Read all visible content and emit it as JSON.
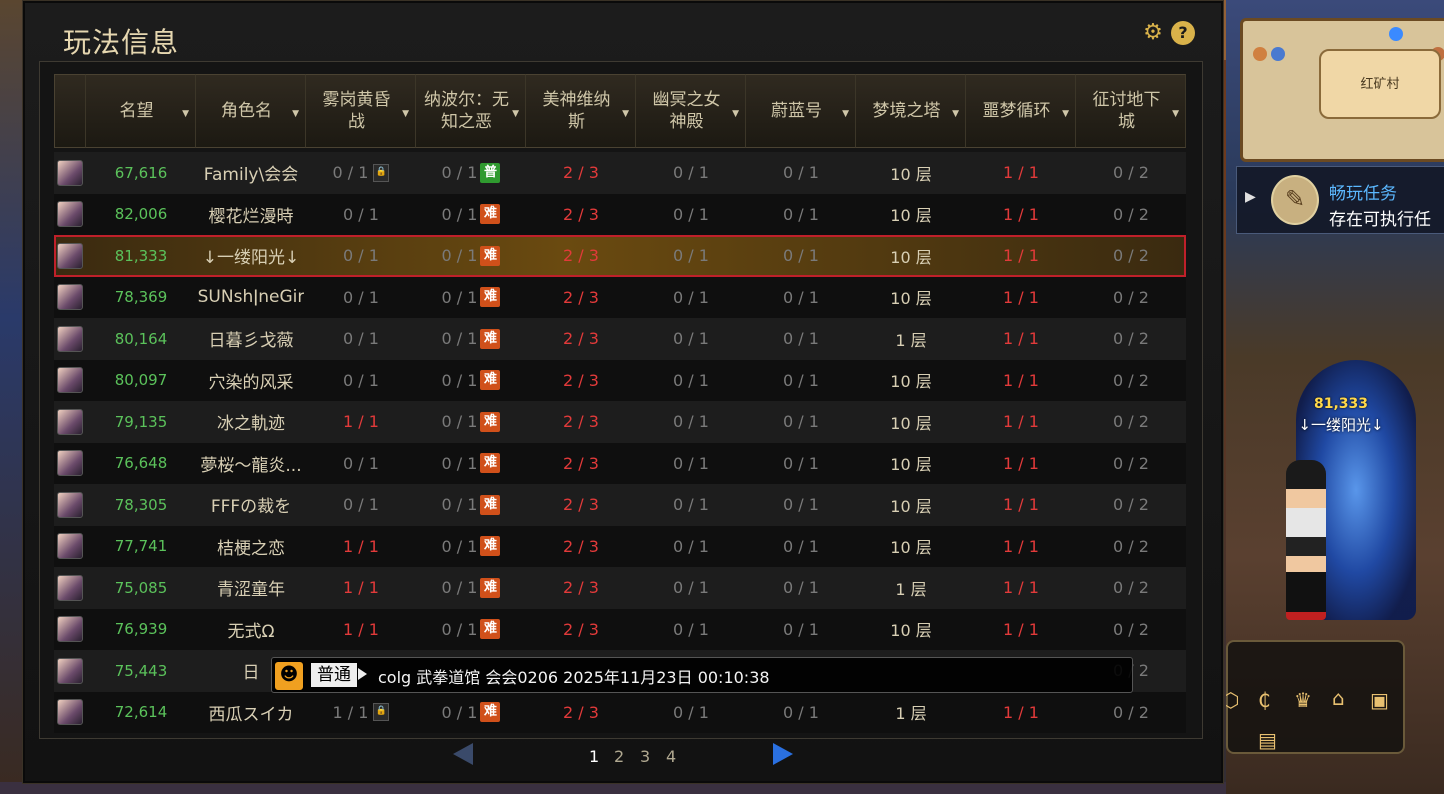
{
  "panel": {
    "title": "玩法信息",
    "gear_icon": "gear-icon",
    "help_icon": "help-icon",
    "help_label": "?"
  },
  "columns": [
    {
      "label": "名望"
    },
    {
      "label": "角色名"
    },
    {
      "label": "雾岗黄昏战"
    },
    {
      "label": "纳波尔：无知之恶"
    },
    {
      "label": "美神维纳斯"
    },
    {
      "label": "幽冥之女神殿"
    },
    {
      "label": "蔚蓝号"
    },
    {
      "label": "梦境之塔"
    },
    {
      "label": "噩梦循环"
    },
    {
      "label": "征讨地下城"
    }
  ],
  "rows": [
    {
      "fame": "67,616",
      "name": "Family\\会会",
      "c3": "0 / 1",
      "c3_lock": true,
      "c4": "0 / 1",
      "c4_badge": "普",
      "c5": "2 / 3",
      "c6": "0 / 1",
      "c7": "0 / 1",
      "c8": "10 层",
      "c9": "1 / 1",
      "c10": "0 / 2"
    },
    {
      "fame": "82,006",
      "name": "樱花烂漫時",
      "c3": "0 / 1",
      "c4": "0 / 1",
      "c4_badge": "难",
      "c5": "2 / 3",
      "c6": "0 / 1",
      "c7": "0 / 1",
      "c8": "10 层",
      "c9": "1 / 1",
      "c10": "0 / 2"
    },
    {
      "fame": "81,333",
      "name": "↓一缕阳光↓",
      "c3": "0 / 1",
      "c4": "0 / 1",
      "c4_badge": "难",
      "c5": "2 / 3",
      "c6": "0 / 1",
      "c7": "0 / 1",
      "c8": "10 层",
      "c9": "1 / 1",
      "c10": "0 / 2",
      "selected": true
    },
    {
      "fame": "78,369",
      "name": "SUNshǀneGir",
      "c3": "0 / 1",
      "c4": "0 / 1",
      "c4_badge": "难",
      "c5": "2 / 3",
      "c6": "0 / 1",
      "c7": "0 / 1",
      "c8": "10 层",
      "c9": "1 / 1",
      "c10": "0 / 2"
    },
    {
      "fame": "80,164",
      "name": "日暮彡戈薇",
      "c3": "0 / 1",
      "c4": "0 / 1",
      "c4_badge": "难",
      "c5": "2 / 3",
      "c6": "0 / 1",
      "c7": "0 / 1",
      "c8": "1 层",
      "c9": "1 / 1",
      "c10": "0 / 2"
    },
    {
      "fame": "80,097",
      "name": "穴染的风采",
      "c3": "0 / 1",
      "c4": "0 / 1",
      "c4_badge": "难",
      "c5": "2 / 3",
      "c6": "0 / 1",
      "c7": "0 / 1",
      "c8": "10 层",
      "c9": "1 / 1",
      "c10": "0 / 2"
    },
    {
      "fame": "79,135",
      "name": "冰之軌迹",
      "c3": "1 / 1",
      "c3_red": true,
      "c4": "0 / 1",
      "c4_badge": "难",
      "c5": "2 / 3",
      "c6": "0 / 1",
      "c7": "0 / 1",
      "c8": "10 层",
      "c9": "1 / 1",
      "c10": "0 / 2"
    },
    {
      "fame": "76,648",
      "name": "夢桜～龍炎...",
      "c3": "0 / 1",
      "c4": "0 / 1",
      "c4_badge": "难",
      "c5": "2 / 3",
      "c6": "0 / 1",
      "c7": "0 / 1",
      "c8": "10 层",
      "c9": "1 / 1",
      "c10": "0 / 2"
    },
    {
      "fame": "78,305",
      "name": "FFFの裁を",
      "c3": "0 / 1",
      "c4": "0 / 1",
      "c4_badge": "难",
      "c5": "2 / 3",
      "c6": "0 / 1",
      "c7": "0 / 1",
      "c8": "10 层",
      "c9": "1 / 1",
      "c10": "0 / 2"
    },
    {
      "fame": "77,741",
      "name": "桔梗之恋",
      "c3": "1 / 1",
      "c3_red": true,
      "c4": "0 / 1",
      "c4_badge": "难",
      "c5": "2 / 3",
      "c6": "0 / 1",
      "c7": "0 / 1",
      "c8": "10 层",
      "c9": "1 / 1",
      "c10": "0 / 2"
    },
    {
      "fame": "75,085",
      "name": "青涩童年",
      "c3": "1 / 1",
      "c3_red": true,
      "c4": "0 / 1",
      "c4_badge": "难",
      "c5": "2 / 3",
      "c6": "0 / 1",
      "c7": "0 / 1",
      "c8": "1 层",
      "c9": "1 / 1",
      "c10": "0 / 2"
    },
    {
      "fame": "76,939",
      "name": "无式Ω",
      "c3": "1 / 1",
      "c3_red": true,
      "c4": "0 / 1",
      "c4_badge": "难",
      "c5": "2 / 3",
      "c6": "0 / 1",
      "c7": "0 / 1",
      "c8": "10 层",
      "c9": "1 / 1",
      "c10": "0 / 2"
    },
    {
      "fame": "75,443",
      "name": "日",
      "c3": "",
      "c4": "",
      "c5": "",
      "c6": "",
      "c7": "",
      "c8": "",
      "c9": "",
      "c10": "0 / 2"
    },
    {
      "fame": "72,614",
      "name": "西瓜スイカ",
      "c3": "1 / 1",
      "c3_lock": true,
      "c4": "0 / 1",
      "c4_badge": "难",
      "c5": "2 / 3",
      "c6": "0 / 1",
      "c7": "0 / 1",
      "c8": "1 层",
      "c9": "1 / 1",
      "c10": "0 / 2"
    }
  ],
  "chat": {
    "channel": "普通",
    "message": "colg 武拳道馆 会会0206 2025年11月23日 00:10:38"
  },
  "pagination": {
    "pages": [
      "1",
      "2",
      "3",
      "4"
    ],
    "current": "1"
  },
  "minimap": {
    "town": "红矿村"
  },
  "quest": {
    "title": "畅玩任务",
    "subtitle": "存在可执行任"
  },
  "player_tag": {
    "fame": "81,333",
    "name": "↓一缕阳光↓"
  },
  "colors": {
    "fame_green": "#5bc25b",
    "clear_red": "#e23a3a",
    "hard_badge": "#d0501a",
    "normal_badge": "#2f9a2f",
    "selection_border": "#c0202a"
  }
}
